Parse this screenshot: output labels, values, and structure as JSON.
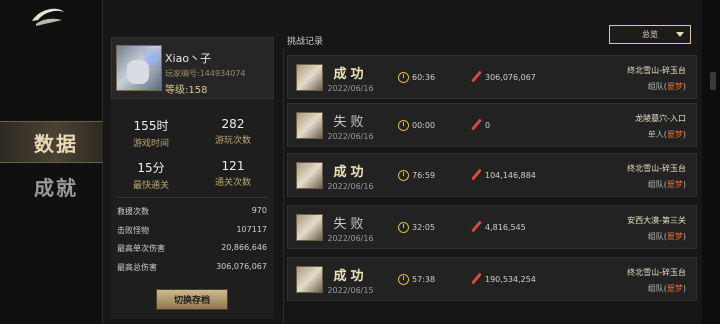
{
  "nav": {
    "items": [
      {
        "label": "数据",
        "active": true
      },
      {
        "label": "成就",
        "active": false
      }
    ]
  },
  "profile": {
    "username": "Xiao丶子",
    "player_id": "玩家编号:144934074",
    "level": "等级:158",
    "stats": [
      {
        "value": "155时",
        "label": "游戏时间"
      },
      {
        "value": "282",
        "label": "游玩次数"
      },
      {
        "value": "15分",
        "label": "最快通关"
      },
      {
        "value": "121",
        "label": "通关次数"
      }
    ],
    "details": [
      {
        "label": "救援次数",
        "value": "970"
      },
      {
        "label": "击败怪物",
        "value": "107117"
      },
      {
        "label": "最高单次伤害",
        "value": "20,866,646"
      },
      {
        "label": "最高总伤害",
        "value": "306,076,067"
      }
    ],
    "switch_label": "切换存档"
  },
  "records": {
    "title": "挑战记录",
    "filter": "总览",
    "items": [
      {
        "result": "成功",
        "win": true,
        "date": "2022/06/16",
        "time": "60:36",
        "damage": "306,076,067",
        "stage": "终北雪山-碎玉台",
        "mode": "组队",
        "difficulty": "噩梦"
      },
      {
        "result": "失败",
        "win": false,
        "date": "2022/06/16",
        "time": "00:00",
        "damage": "0",
        "stage": "龙陵墓穴-入口",
        "mode": "单人",
        "difficulty": "噩梦"
      },
      {
        "result": "成功",
        "win": true,
        "date": "2022/06/16",
        "time": "76:59",
        "damage": "104,146,884",
        "stage": "终北雪山-碎玉台",
        "mode": "组队",
        "difficulty": "噩梦"
      },
      {
        "result": "失败",
        "win": false,
        "date": "2022/06/16",
        "time": "32:05",
        "damage": "4,816,545",
        "stage": "安西大漠-第三关",
        "mode": "组队",
        "difficulty": "噩梦"
      },
      {
        "result": "成功",
        "win": true,
        "date": "2022/06/15",
        "time": "57:38",
        "damage": "190,534,254",
        "stage": "终北雪山-碎玉台",
        "mode": "组队",
        "difficulty": "噩梦"
      }
    ]
  },
  "colors": {
    "accent_gold": "#d6c58f",
    "difficulty": "#e06a32",
    "clock": "#e0b93b",
    "damage_icon": "#d84b3b"
  },
  "icons": [
    "logo-icon",
    "clock-icon",
    "sword-icon",
    "dropdown-caret-icon"
  ]
}
